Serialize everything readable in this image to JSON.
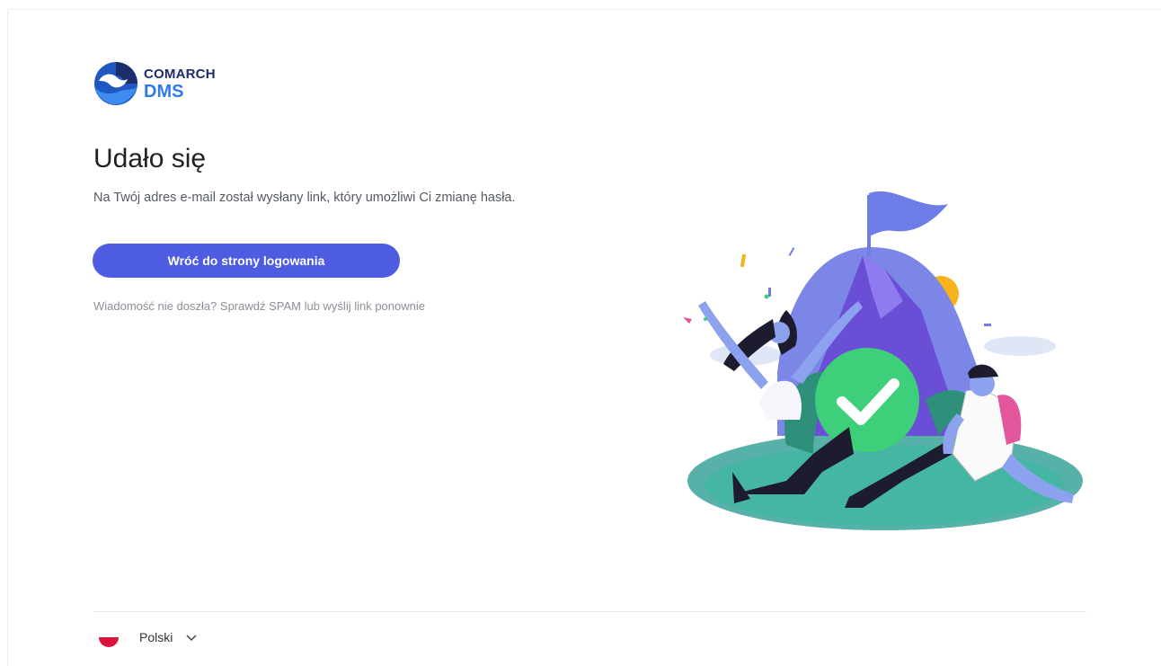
{
  "brand": {
    "line1": "COMARCH",
    "line2": "DMS"
  },
  "main": {
    "title": "Udało się",
    "description": "Na Twój adres e-mail został wysłany link, który umożliwi Ci zmianę hasła.",
    "back_button_label": "Wróć do strony logowania",
    "resend_text": "Wiadomość nie doszła? Sprawdź SPAM lub wyślij link ponownie"
  },
  "footer": {
    "language_label": "Polski"
  },
  "colors": {
    "primary_button": "#4d5ce0",
    "brand_dark": "#1b2d6b",
    "brand_blue": "#2f7ae5",
    "success_green": "#3ecf7a"
  },
  "icons": {
    "logo": "comarch-logo-icon",
    "illustration": "success-illustration",
    "check": "check-icon",
    "flag": "poland-flag-icon",
    "chevron": "chevron-down-icon"
  }
}
